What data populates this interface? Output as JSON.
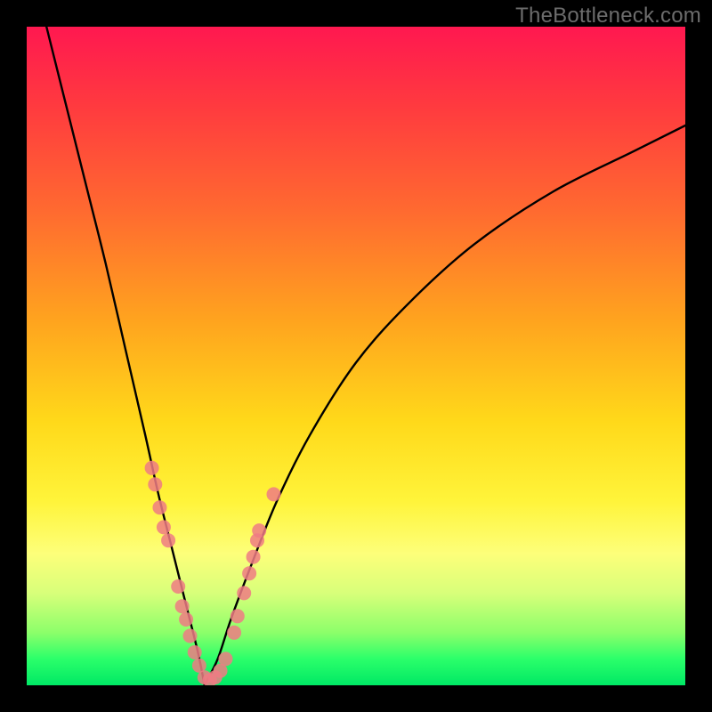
{
  "watermark": "TheBottleneck.com",
  "chart_data": {
    "type": "line",
    "title": "",
    "xlabel": "",
    "ylabel": "",
    "xlim": [
      0,
      100
    ],
    "ylim": [
      0,
      100
    ],
    "note": "V-shaped bottleneck curve over rainbow gradient. Minimum near x≈27. Left branch steeper than right branch. Pink dots cluster on both branches in the lower third.",
    "series": [
      {
        "name": "left-branch",
        "x": [
          3,
          6,
          9,
          12,
          15,
          18,
          20,
          22,
          24,
          26,
          27
        ],
        "y": [
          100,
          88,
          76,
          64,
          51,
          38,
          29,
          21,
          13,
          5,
          0
        ]
      },
      {
        "name": "right-branch",
        "x": [
          27,
          29,
          31,
          34,
          38,
          43,
          50,
          58,
          68,
          80,
          92,
          100
        ],
        "y": [
          0,
          4,
          10,
          18,
          28,
          38,
          49,
          58,
          67,
          75,
          81,
          85
        ]
      }
    ],
    "dots": {
      "name": "samples",
      "color": "#ef7b84",
      "radius_px": 8,
      "points": [
        {
          "x": 19.0,
          "y": 33.0
        },
        {
          "x": 19.5,
          "y": 30.5
        },
        {
          "x": 20.2,
          "y": 27.0
        },
        {
          "x": 20.8,
          "y": 24.0
        },
        {
          "x": 21.5,
          "y": 22.0
        },
        {
          "x": 23.0,
          "y": 15.0
        },
        {
          "x": 23.6,
          "y": 12.0
        },
        {
          "x": 24.2,
          "y": 10.0
        },
        {
          "x": 24.8,
          "y": 7.5
        },
        {
          "x": 25.5,
          "y": 5.0
        },
        {
          "x": 26.2,
          "y": 3.0
        },
        {
          "x": 27.0,
          "y": 1.2
        },
        {
          "x": 27.8,
          "y": 0.8
        },
        {
          "x": 28.6,
          "y": 1.2
        },
        {
          "x": 29.4,
          "y": 2.2
        },
        {
          "x": 30.2,
          "y": 4.0
        },
        {
          "x": 31.5,
          "y": 8.0
        },
        {
          "x": 32.0,
          "y": 10.5
        },
        {
          "x": 33.0,
          "y": 14.0
        },
        {
          "x": 33.8,
          "y": 17.0
        },
        {
          "x": 34.4,
          "y": 19.5
        },
        {
          "x": 35.0,
          "y": 22.0
        },
        {
          "x": 35.3,
          "y": 23.5
        },
        {
          "x": 37.5,
          "y": 29.0
        }
      ]
    }
  }
}
